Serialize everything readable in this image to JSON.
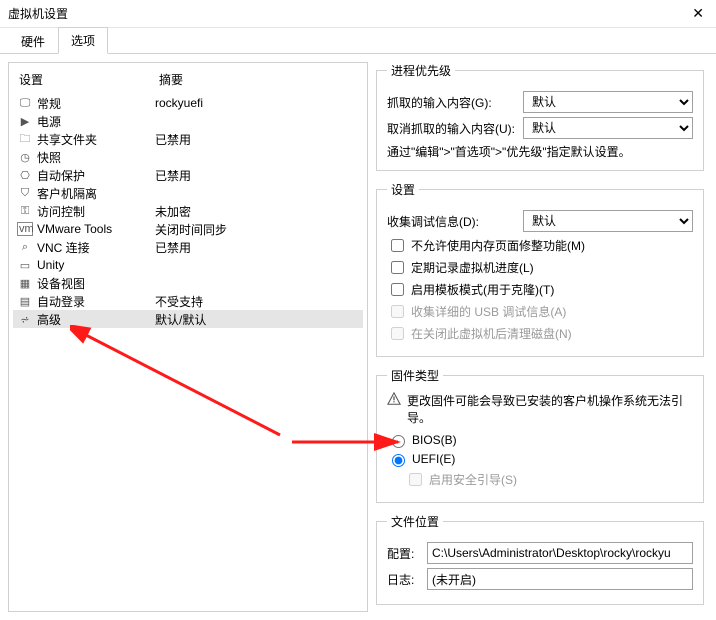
{
  "window_title": "虚拟机设置",
  "tabs": {
    "hardware": "硬件",
    "options": "选项"
  },
  "left": {
    "h_setting": "设置",
    "h_summary": "摘要",
    "items": [
      {
        "name": "常规",
        "summary": "rockyuefi"
      },
      {
        "name": "电源",
        "summary": ""
      },
      {
        "name": "共享文件夹",
        "summary": "已禁用"
      },
      {
        "name": "快照",
        "summary": ""
      },
      {
        "name": "自动保护",
        "summary": "已禁用"
      },
      {
        "name": "客户机隔离",
        "summary": ""
      },
      {
        "name": "访问控制",
        "summary": "未加密"
      },
      {
        "name": "VMware Tools",
        "summary": "关闭时间同步"
      },
      {
        "name": "VNC 连接",
        "summary": "已禁用"
      },
      {
        "name": "Unity",
        "summary": ""
      },
      {
        "name": "设备视图",
        "summary": ""
      },
      {
        "name": "自动登录",
        "summary": "不受支持"
      },
      {
        "name": "高级",
        "summary": "默认/默认"
      }
    ]
  },
  "priority": {
    "legend": "进程优先级",
    "grabbed_label": "抓取的输入内容(G):",
    "grabbed_value": "默认",
    "ungrabbed_label": "取消抓取的输入内容(U):",
    "ungrabbed_value": "默认",
    "hint": "通过\"编辑\">\"首选项\">\"优先级\"指定默认设置。"
  },
  "settings": {
    "legend": "设置",
    "debug_label": "收集调试信息(D):",
    "debug_value": "默认",
    "cb_mem": "不允许使用内存页面修整功能(M)",
    "cb_log": "定期记录虚拟机进度(L)",
    "cb_template": "启用模板模式(用于克隆)(T)",
    "cb_usb": "收集详细的 USB 调试信息(A)",
    "cb_clean": "在关闭此虚拟机后清理磁盘(N)"
  },
  "firmware": {
    "legend": "固件类型",
    "warn": "更改固件可能会导致已安装的客户机操作系统无法引导。",
    "bios": "BIOS(B)",
    "uefi": "UEFI(E)",
    "secure": "启用安全引导(S)"
  },
  "fileloc": {
    "legend": "文件位置",
    "config_label": "配置:",
    "config_value": "C:\\Users\\Administrator\\Desktop\\rocky\\rockyu",
    "log_label": "日志:",
    "log_value": "(未开启)"
  }
}
